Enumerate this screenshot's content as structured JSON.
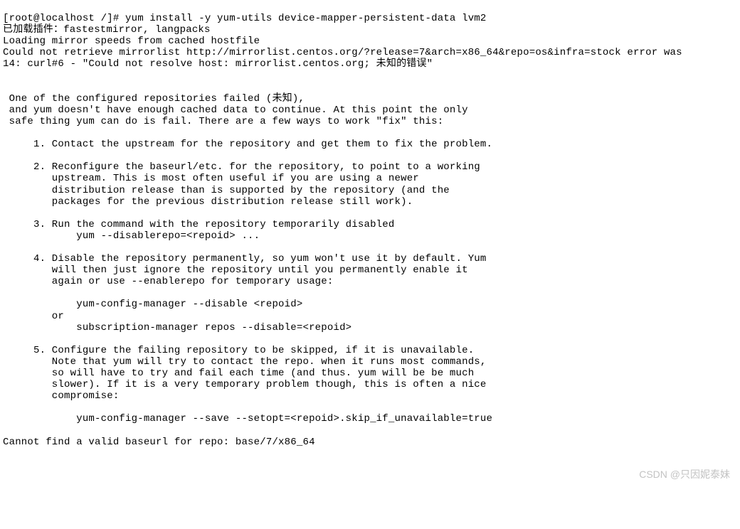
{
  "terminal": {
    "output": "[root@localhost /]# yum install -y yum-utils device-mapper-persistent-data lvm2\n已加载插件：fastestmirror, langpacks\nLoading mirror speeds from cached hostfile\nCould not retrieve mirrorlist http://mirrorlist.centos.org/?release=7&arch=x86_64&repo=os&infra=stock error was\n14: curl#6 - \"Could not resolve host: mirrorlist.centos.org; 未知的错误\"\n\n\n One of the configured repositories failed (未知),\n and yum doesn't have enough cached data to continue. At this point the only\n safe thing yum can do is fail. There are a few ways to work \"fix\" this:\n\n     1. Contact the upstream for the repository and get them to fix the problem.\n\n     2. Reconfigure the baseurl/etc. for the repository, to point to a working\n        upstream. This is most often useful if you are using a newer\n        distribution release than is supported by the repository (and the\n        packages for the previous distribution release still work).\n\n     3. Run the command with the repository temporarily disabled\n            yum --disablerepo=<repoid> ...\n\n     4. Disable the repository permanently, so yum won't use it by default. Yum\n        will then just ignore the repository until you permanently enable it\n        again or use --enablerepo for temporary usage:\n\n            yum-config-manager --disable <repoid>\n        or\n            subscription-manager repos --disable=<repoid>\n\n     5. Configure the failing repository to be skipped, if it is unavailable.\n        Note that yum will try to contact the repo. when it runs most commands,\n        so will have to try and fail each time (and thus. yum will be be much\n        slower). If it is a very temporary problem though, this is often a nice\n        compromise:\n\n            yum-config-manager --save --setopt=<repoid>.skip_if_unavailable=true\n\nCannot find a valid baseurl for repo: base/7/x86_64"
  },
  "watermark": {
    "text": "CSDN @只因妮泰妹"
  }
}
